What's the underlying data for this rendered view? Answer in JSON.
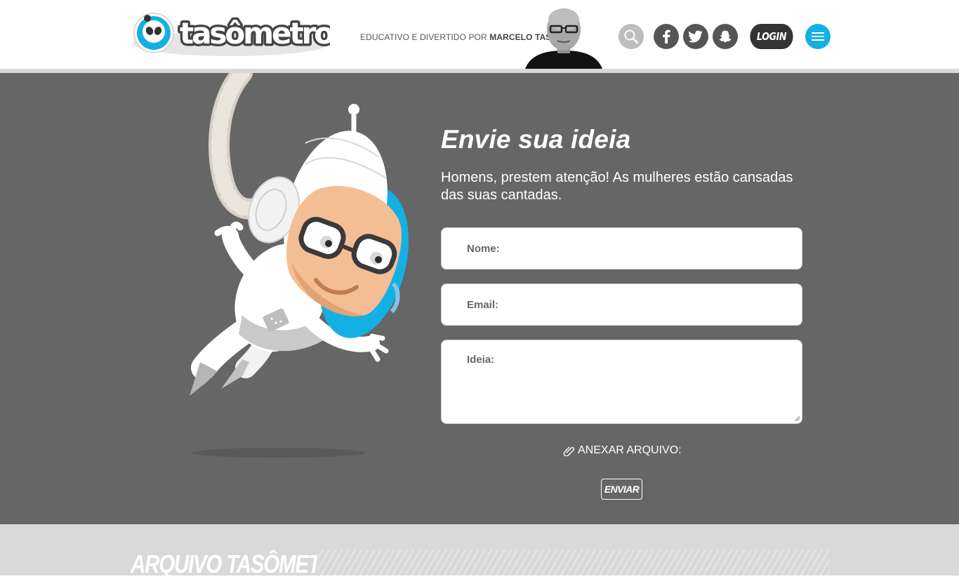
{
  "header": {
    "logo_text": "tasômetro",
    "byline_prefix": "EDUCATIVO E DIVERTIDO POR ",
    "byline_author": "MARCELO TAS",
    "login_label": "LOGIN",
    "icons": [
      "search-icon",
      "facebook-icon",
      "twitter-icon",
      "snapchat-icon",
      "menu-icon"
    ]
  },
  "form": {
    "title": "Envie sua ideia",
    "subtitle": "Homens, prestem atenção! As mulheres estão cansadas das suas cantadas.",
    "name_label": "Nome:",
    "email_label": "Email:",
    "idea_label": "Ideia:",
    "attach_label": "ANEXAR ARQUIVO:",
    "submit_label": "ENVIAR"
  },
  "archive": {
    "title": "ARQUIVO TASÔMETRO"
  },
  "colors": {
    "accent": "#15b0e3",
    "panel": "#666666",
    "dark_button": "#333333",
    "archive_bg": "#d9d9d9"
  }
}
